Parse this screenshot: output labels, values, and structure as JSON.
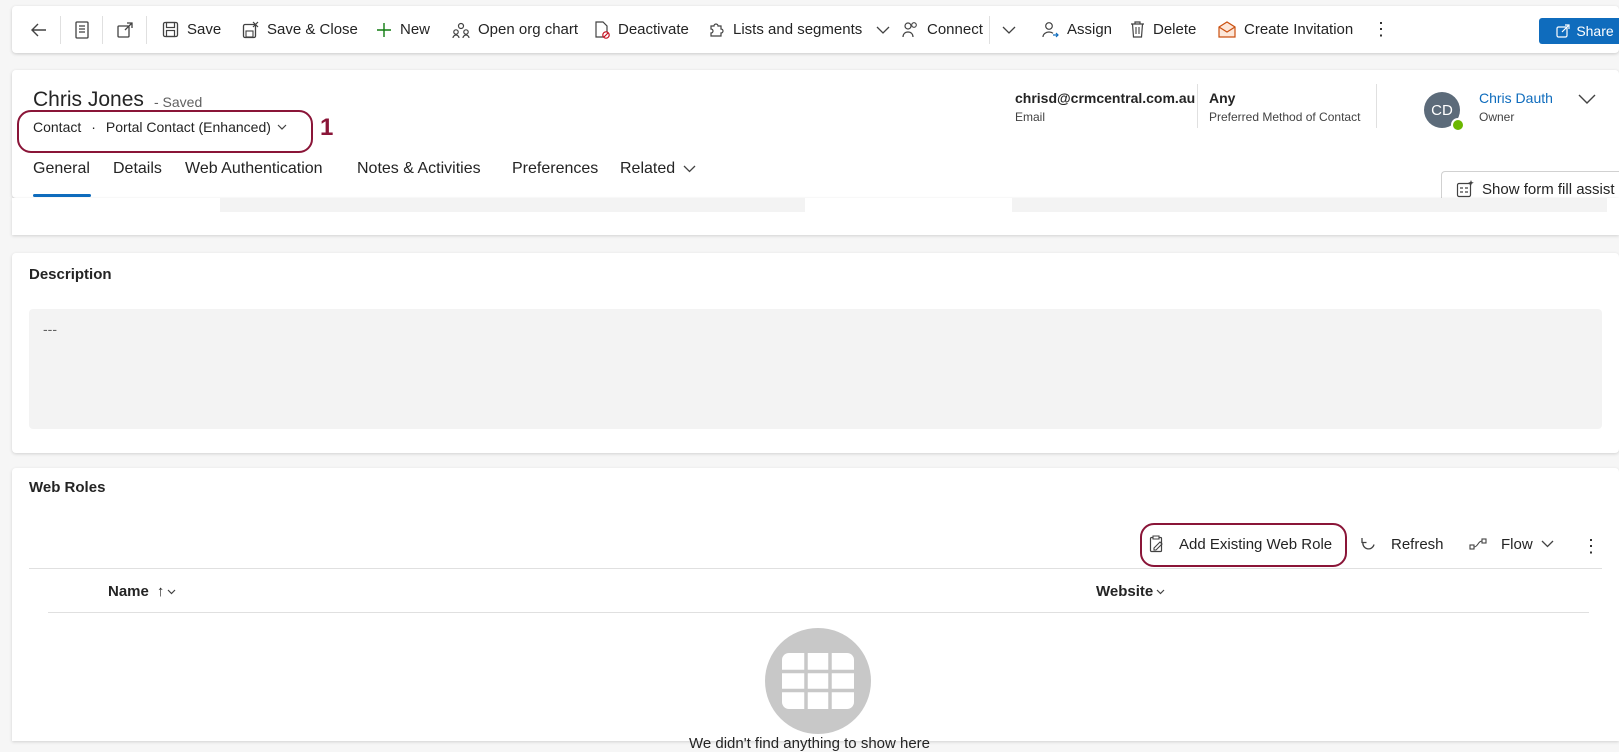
{
  "toolbar": {
    "save": "Save",
    "save_close": "Save & Close",
    "new": "New",
    "org_chart": "Open org chart",
    "deactivate": "Deactivate",
    "lists_segments": "Lists and segments",
    "connect": "Connect",
    "assign": "Assign",
    "delete": "Delete",
    "create_invitation": "Create Invitation",
    "share": "Share"
  },
  "header": {
    "name": "Chris Jones",
    "saved": "- Saved",
    "entity": "Contact",
    "form_name": "Portal Contact (Enhanced)",
    "annotation": "1",
    "email_value": "chrisd@crmcentral.com.au",
    "email_label": "Email",
    "pmc_value": "Any",
    "pmc_label": "Preferred Method of Contact",
    "owner_initials": "CD",
    "owner_name": "Chris Dauth",
    "owner_label": "Owner"
  },
  "tabs": [
    "General",
    "Details",
    "Web Authentication",
    "Notes & Activities",
    "Preferences",
    "Related"
  ],
  "form_fill_assist": "Show form fill assist",
  "description": {
    "title": "Description",
    "value": "---"
  },
  "web_roles": {
    "title": "Web Roles",
    "add_existing": "Add Existing Web Role",
    "refresh": "Refresh",
    "flow": "Flow",
    "col_name": "Name",
    "col_website": "Website",
    "empty_text": "We didn't find anything to show here"
  },
  "colors": {
    "accent": "#0f6cbd",
    "annotation": "#8a1538",
    "presence": "#6bb700"
  }
}
